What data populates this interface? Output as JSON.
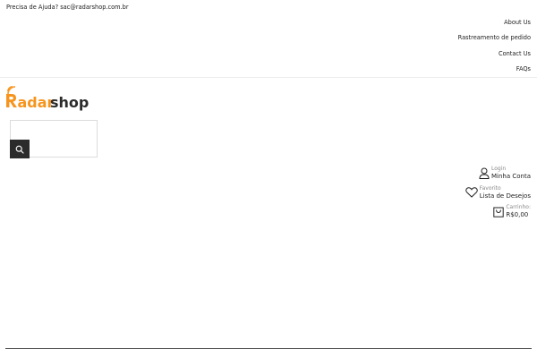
{
  "topbar": {
    "help_text": "Precisa de Ajuda? sac@radarshop.com.br"
  },
  "top_links": [
    {
      "label": "About Us"
    },
    {
      "label": "Rastreamento de pedido"
    },
    {
      "label": "Contact Us"
    },
    {
      "label": "FAQs"
    }
  ],
  "logo": {
    "text_first": "adar",
    "text_second": "shop",
    "accent_color": "#f7941d",
    "dark_color": "#2b2b2b"
  },
  "search": {
    "placeholder": "",
    "button_icon": "search-icon"
  },
  "account": {
    "login_small": "Login",
    "login_main": "Minha Conta",
    "login_icon": "user-icon",
    "wishlist_small": "Favorito",
    "wishlist_main": "Lista de Desejos",
    "wishlist_icon": "heart-icon",
    "cart_small": "Carrinho:",
    "cart_main": "R$0,00",
    "cart_icon": "shopping-bag-icon"
  }
}
